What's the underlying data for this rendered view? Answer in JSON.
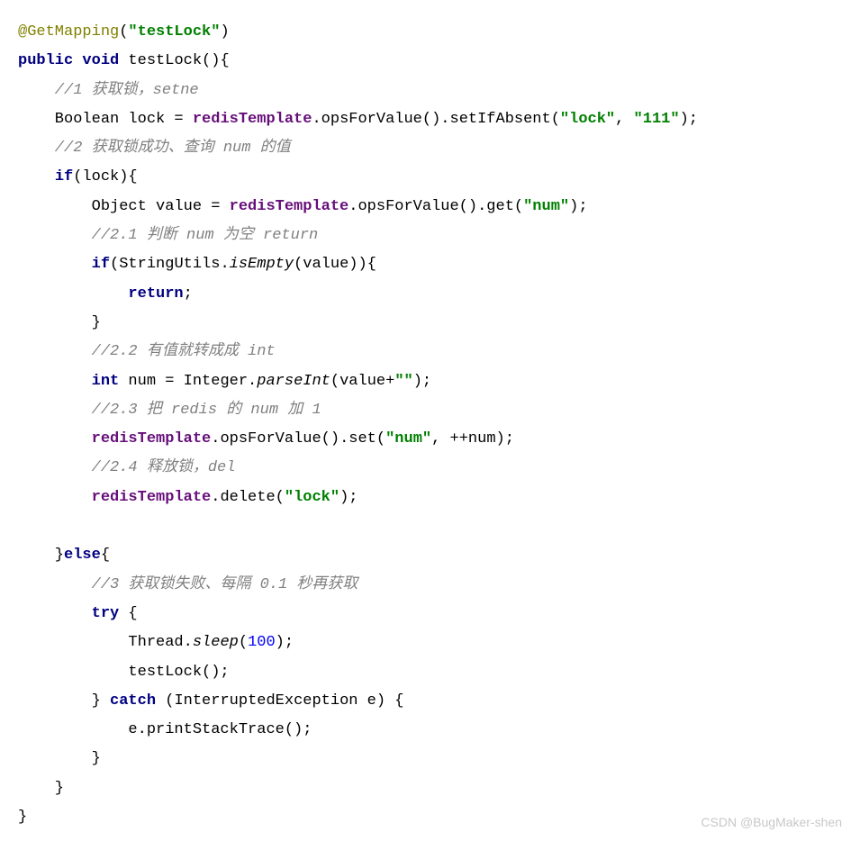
{
  "code": {
    "l1a": "@GetMapping",
    "l1b": "(",
    "l1c": "\"testLock\"",
    "l1d": ")",
    "l2a": "public",
    "l2b": " ",
    "l2c": "void",
    "l2d": " testLock(){",
    "l3": "    //1 获取锁，setne",
    "l4a": "    Boolean lock = ",
    "l4b": "redisTemplate",
    "l4c": ".opsForValue().setIfAbsent(",
    "l4d": "\"lock\"",
    "l4e": ", ",
    "l4f": "\"111\"",
    "l4g": ");",
    "l5": "    //2 获取锁成功、查询 num 的值",
    "l6a": "    ",
    "l6b": "if",
    "l6c": "(lock){",
    "l7a": "        Object value = ",
    "l7b": "redisTemplate",
    "l7c": ".opsForValue().get(",
    "l7d": "\"num\"",
    "l7e": ");",
    "l8": "        //2.1 判断 num 为空 return",
    "l9a": "        ",
    "l9b": "if",
    "l9c": "(StringUtils.",
    "l9d": "isEmpty",
    "l9e": "(value)){",
    "l10a": "            ",
    "l10b": "return",
    "l10c": ";",
    "l11": "        }",
    "l12": "        //2.2 有值就转成成 int",
    "l13a": "        ",
    "l13b": "int",
    "l13c": " num = Integer.",
    "l13d": "parseInt",
    "l13e": "(value+",
    "l13f": "\"\"",
    "l13g": ");",
    "l14": "        //2.3 把 redis 的 num 加 1",
    "l15a": "        ",
    "l15b": "redisTemplate",
    "l15c": ".opsForValue().set(",
    "l15d": "\"num\"",
    "l15e": ", ++num);",
    "l16": "        //2.4 释放锁，del",
    "l17a": "        ",
    "l17b": "redisTemplate",
    "l17c": ".delete(",
    "l17d": "\"lock\"",
    "l17e": ");",
    "l18": "",
    "l19a": "    }",
    "l19b": "else",
    "l19c": "{",
    "l20": "        //3 获取锁失败、每隔 0.1 秒再获取",
    "l21a": "        ",
    "l21b": "try",
    "l21c": " {",
    "l22a": "            Thread.",
    "l22b": "sleep",
    "l22c": "(",
    "l22d": "100",
    "l22e": ");",
    "l23": "            testLock();",
    "l24a": "        } ",
    "l24b": "catch",
    "l24c": " (InterruptedException e) {",
    "l25": "            e.printStackTrace();",
    "l26": "        }",
    "l27": "    }",
    "l28": "}"
  },
  "watermark": "CSDN @BugMaker-shen"
}
